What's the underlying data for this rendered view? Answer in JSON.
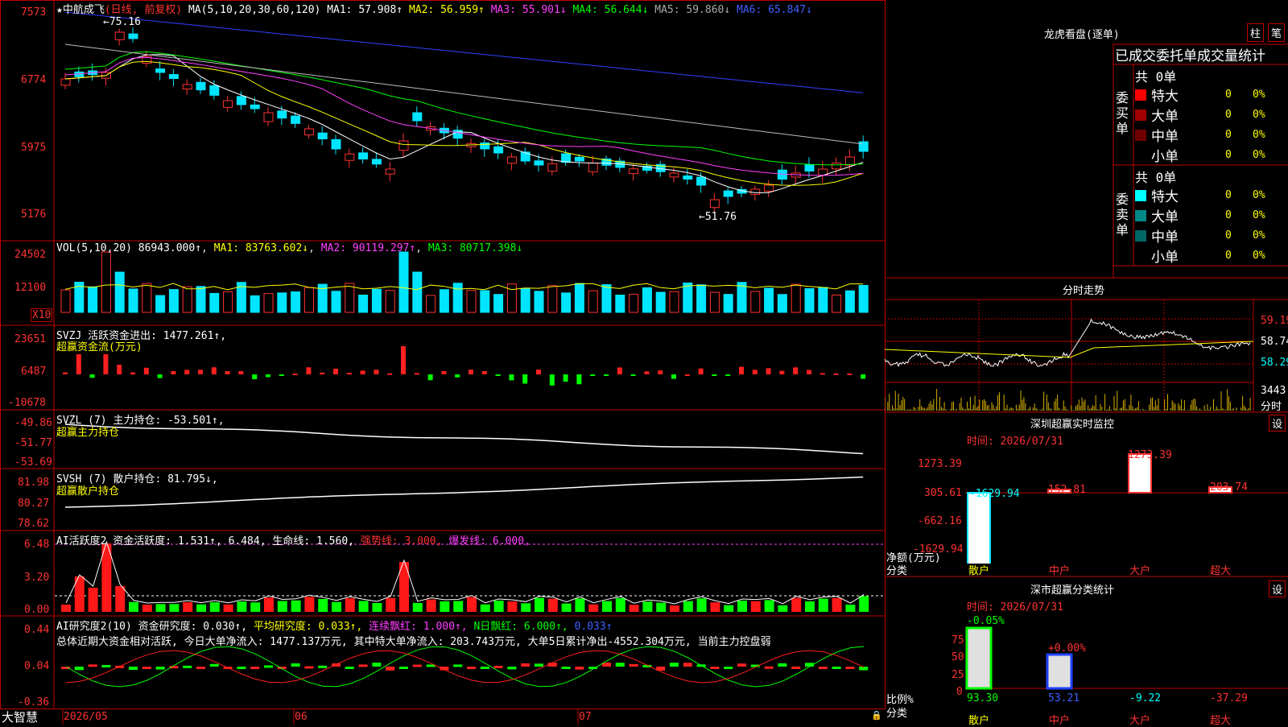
{
  "stock": {
    "name": "中航成飞",
    "mode": "(日线, 前复权)",
    "ma_label": "MA(5,10,20,30,60,120)",
    "ma": [
      [
        "MA1: ",
        "57.908↑"
      ],
      [
        "MA2: ",
        "56.959↑"
      ],
      [
        "MA3: ",
        "55.901↓"
      ],
      [
        "MA4: ",
        "56.644↓"
      ],
      [
        "MA5: ",
        "59.860↓"
      ],
      [
        "MA6: ",
        "65.847↓"
      ]
    ],
    "y_ticks": [
      "7573",
      "6774",
      "5975",
      "5176"
    ],
    "hi_mark": "←75.16",
    "lo_mark": "←51.76"
  },
  "vol": {
    "label": "VOL(5,10,20)",
    "value": "86943.000↑",
    "ma": [
      [
        "MA1: ",
        "83763.602↓"
      ],
      [
        "MA2: ",
        "90119.297↑"
      ],
      [
        "MA3: ",
        "80717.398↓"
      ]
    ],
    "y_ticks": [
      "24502",
      "12100"
    ],
    "unit": "X10"
  },
  "svzj": {
    "label": "SVZJ  活跃资金进出: 1477.261↑,",
    "sub": "超赢资金流(万元)",
    "y_ticks": [
      "23651",
      "6487",
      "-10678"
    ]
  },
  "svzl": {
    "label": "SVZL (7) 主力持仓: -53.501↑,",
    "sub": "超赢主力持仓",
    "y_ticks": [
      "-49.86",
      "-51.77",
      "-53.69"
    ]
  },
  "svsh": {
    "label": "SVSH (7) 散户持仓: 81.795↓,",
    "sub": "超赢散户持仓",
    "y_ticks": [
      "81.98",
      "80.27",
      "78.62"
    ]
  },
  "ai1": {
    "label": "AI活跃度2 资金活跃度: 1.531↑, 6.484, 生命线: 1.560,",
    "strong": "强势线: 3.000,",
    "burst": "爆发线: 6.000,",
    "y_ticks": [
      "6.48",
      "3.20",
      "0.00"
    ]
  },
  "ai2": {
    "label": "AI研究度2(10) 资金研究度: 0.030↑,",
    "avg": "平均研究度: 0.033↑,",
    "cont": "连续飘红: 1.000↑,",
    "n": "N日飘红: 6.000↑,",
    "last": "0.033↑",
    "summary": "总体近期大资金相对活跃, 今日大单净流入: 1477.137万元, 其中特大单净流入: 203.743万元, 大单5日累计净出-4552.304万元, 当前主力控盘弱",
    "y_ticks": [
      "0.44",
      "0.04",
      "-0.36"
    ]
  },
  "x_axis": [
    "2026/05",
    "06",
    "07"
  ],
  "brand": "大智慧",
  "lhb": {
    "title": "龙虎看盘(逐单)",
    "btn1": "柱",
    "btn2": "笔",
    "header": "已成交委托单成交量统计",
    "buy": {
      "side": "委买单",
      "total": "共 0单",
      "rows": [
        [
          "特大",
          "0",
          "0%",
          "#ff0000"
        ],
        [
          "大单",
          "0",
          "0%",
          "#a00000"
        ],
        [
          "中单",
          "0",
          "0%",
          "#700000"
        ],
        [
          "小单",
          "0",
          "0%",
          ""
        ]
      ]
    },
    "sell": {
      "side": "委卖单",
      "total": "共 0单",
      "rows": [
        [
          "特大",
          "0",
          "0%",
          "#00ffff"
        ],
        [
          "大单",
          "0",
          "0%",
          "#008888"
        ],
        [
          "中单",
          "0",
          "0%",
          "#006666"
        ],
        [
          "小单",
          "0",
          "0%",
          ""
        ]
      ]
    }
  },
  "intraday": {
    "title": "分时走势",
    "prices": [
      "59.19",
      "58.74",
      "58.29"
    ],
    "vol": "3443",
    "vol_unit": "分时"
  },
  "monitor": {
    "title": "深圳超赢实时监控",
    "btn": "设",
    "time": "时间: 2026/07/31",
    "y_ticks": [
      "1273.39",
      "305.61",
      "-662.16",
      "-1629.94"
    ],
    "axis": "净额(万元)",
    "axis2": "分类",
    "bars": [
      [
        "散户",
        "-1629.94"
      ],
      [
        "中户",
        "152.81"
      ],
      [
        "大户",
        "1273.39"
      ],
      [
        "超大",
        "203.74"
      ]
    ]
  },
  "classify": {
    "title": "深市超赢分类统计",
    "btn": "设",
    "time": "时间: 2026/07/31",
    "y_ticks": [
      "75",
      "50",
      "25",
      "0"
    ],
    "axis": "比例%",
    "axis2": "分类",
    "top": [
      "-0.05%",
      "+0.00%"
    ],
    "cats": [
      [
        "散户",
        "93.30"
      ],
      [
        "中户",
        "53.21"
      ],
      [
        "大户",
        "-9.22"
      ],
      [
        "超大",
        "-37.29"
      ]
    ]
  }
}
